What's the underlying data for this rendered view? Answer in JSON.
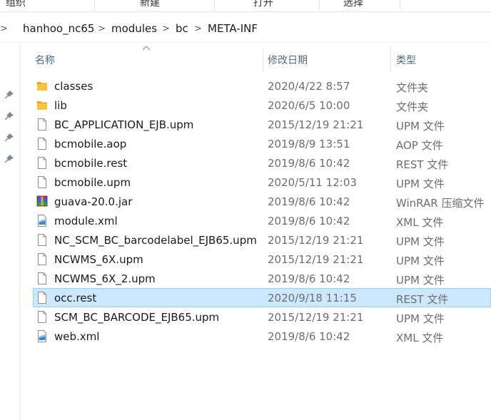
{
  "ribbon": {
    "groups": [
      "组织",
      "新建",
      "打开",
      "选择"
    ]
  },
  "breadcrumb": {
    "items": [
      "hanhoo_nc65",
      "modules",
      "bc",
      "META-INF"
    ]
  },
  "columns": {
    "name": "名称",
    "date": "修改日期",
    "type": "类型"
  },
  "icons": {
    "folder": "folder-icon",
    "file": "document-icon",
    "winrar": "winrar-archive-icon",
    "xml": "xml-file-icon",
    "pin": "pin-icon",
    "sort": "sort-ascending-icon"
  },
  "colors": {
    "selected_row": "#cce8ff",
    "header_text": "#4d6a87",
    "folder": "#f6c343"
  },
  "files": [
    {
      "name": "classes",
      "date": "2020/4/22 8:57",
      "type": "文件夹",
      "icon": "folder"
    },
    {
      "name": "lib",
      "date": "2020/6/5 10:00",
      "type": "文件夹",
      "icon": "folder"
    },
    {
      "name": "BC_APPLICATION_EJB.upm",
      "date": "2015/12/19 21:21",
      "type": "UPM 文件",
      "icon": "file"
    },
    {
      "name": "bcmobile.aop",
      "date": "2019/8/9 13:51",
      "type": "AOP 文件",
      "icon": "file"
    },
    {
      "name": "bcmobile.rest",
      "date": "2019/8/6 10:42",
      "type": "REST 文件",
      "icon": "file"
    },
    {
      "name": "bcmobile.upm",
      "date": "2020/5/11 12:03",
      "type": "UPM 文件",
      "icon": "file"
    },
    {
      "name": "guava-20.0.jar",
      "date": "2019/8/6 10:42",
      "type": "WinRAR 压缩文件",
      "icon": "winrar"
    },
    {
      "name": "module.xml",
      "date": "2019/8/6 10:42",
      "type": "XML 文件",
      "icon": "xml"
    },
    {
      "name": "NC_SCM_BC_barcodelabel_EJB65.upm",
      "date": "2015/12/19 21:21",
      "type": "UPM 文件",
      "icon": "file"
    },
    {
      "name": "NCWMS_6X.upm",
      "date": "2015/12/19 21:21",
      "type": "UPM 文件",
      "icon": "file"
    },
    {
      "name": "NCWMS_6X_2.upm",
      "date": "2019/8/6 10:42",
      "type": "UPM 文件",
      "icon": "file"
    },
    {
      "name": "occ.rest",
      "date": "2020/9/18 11:15",
      "type": "REST 文件",
      "icon": "file",
      "selected": true
    },
    {
      "name": "SCM_BC_BARCODE_EJB65.upm",
      "date": "2015/12/19 21:21",
      "type": "UPM 文件",
      "icon": "file"
    },
    {
      "name": "web.xml",
      "date": "2019/8/6 10:42",
      "type": "XML 文件",
      "icon": "xml"
    }
  ]
}
